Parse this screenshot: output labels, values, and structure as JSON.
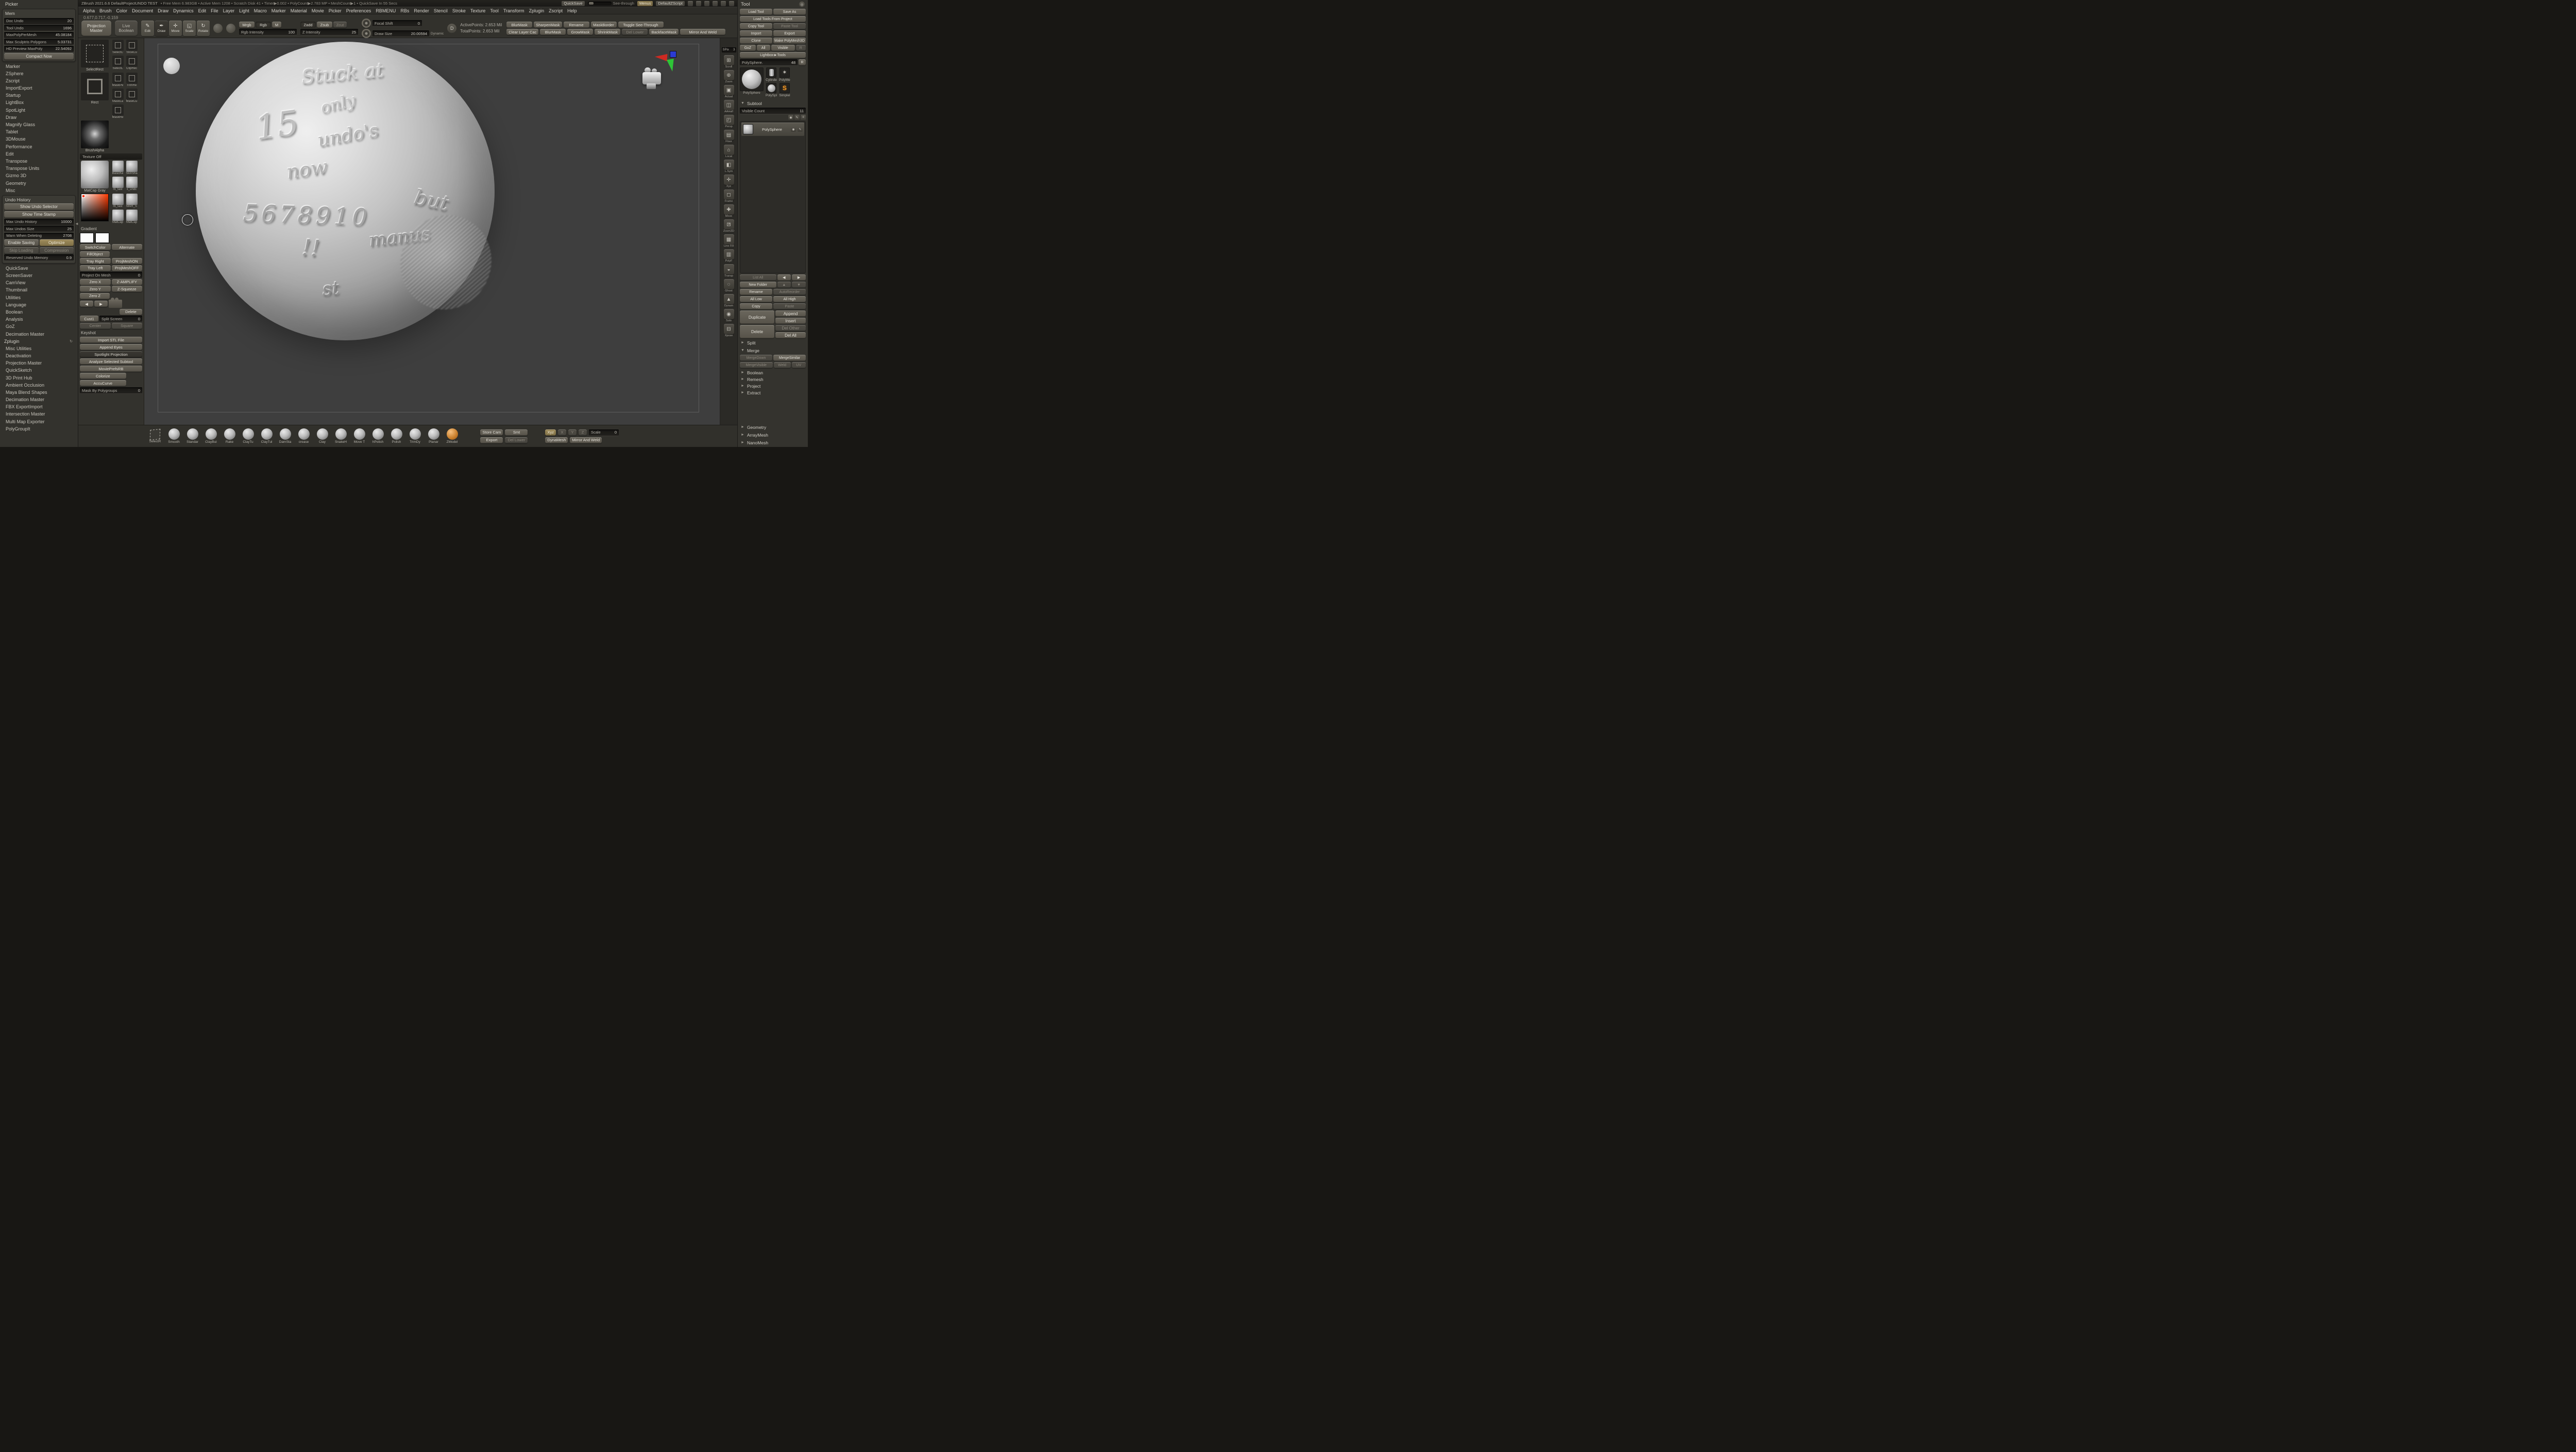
{
  "titlebar": {
    "app_title": "ZBrush 2021.6.6 DefaultProjectUNDO TEST",
    "stats": "• Free Mem 6.983GB • Active Mem 1208 • Scratch Disk 41 • Timer▶0.002 • PolyCount▶2.783 MP • MeshCount▶1 • QuickSave In 55 Secs",
    "quicksave": "QuickSave",
    "see_through": "See-through",
    "menus": "Menus",
    "default_zscript": "DefaultZScript"
  },
  "menubar": [
    "Alpha",
    "Brush",
    "Color",
    "Document",
    "Draw",
    "Dynamics",
    "Edit",
    "File",
    "Layer",
    "Light",
    "Macro",
    "Marker",
    "Material",
    "Movie",
    "Picker",
    "Preferences",
    "RBMENU",
    "RBs",
    "Render",
    "Stencil",
    "Stroke",
    "Texture",
    "Tool",
    "Transform",
    "Zplugin",
    "Zscript",
    "Help"
  ],
  "picker_coords": "0.677,0.717,-0.159",
  "icons": {
    "chevron_right": "►",
    "chevron_left": "◄",
    "chevron_down": "▼",
    "eye": "◉",
    "pencil": "✎",
    "list": "≡",
    "refresh": "↻",
    "circle": "◎"
  },
  "left_tray": {
    "palette_title": "Picker",
    "mem": {
      "title": "Mem",
      "sliders": [
        {
          "label": "Doc Undo",
          "value": "20"
        },
        {
          "label": "Tool Undo",
          "value": "1696"
        },
        {
          "label": "MaxPolyPerMesh",
          "value": "45.08184"
        },
        {
          "label": "Max Sculptris Polygons",
          "value": "5.03731"
        },
        {
          "label": "HD Preview MaxPoly",
          "value": "22.54092"
        }
      ],
      "compact_now": "Compact Now"
    },
    "sections_a": [
      "Marker",
      "ZSphere",
      "Zscript",
      "ImportExport",
      "Startup",
      "LightBox",
      "SpotLight",
      "Draw",
      "Magnify Glass",
      "Tablet",
      "3DMouse",
      "Performance",
      "Edit",
      "Transpose",
      "Transpose Units",
      "Gizmo 3D",
      "Geometry",
      "Misc"
    ],
    "undo_history": {
      "title": "Undo History",
      "buttons_top": [
        "Show Undo Selector",
        "Show Time Stamp"
      ],
      "sliders": [
        {
          "label": "Max Undo History",
          "value": "10000"
        },
        {
          "label": "Max Undos Size",
          "value": "25"
        },
        {
          "label": "Warn When Deleting",
          "value": "2708"
        }
      ],
      "enable_saving": "Enable Saving",
      "optimize": "Optimize",
      "skip_loading": "Skip Loading",
      "compression": "Compression",
      "reserved": {
        "label": "Reserved Undo Memory",
        "value": "0.9"
      }
    },
    "sections_b": [
      "QuickSave",
      "ScreenSaver",
      "CamView",
      "Thumbnail",
      "Utilities",
      "Language",
      "Boolean",
      "Analysis",
      "GoZ",
      "Decimation Master"
    ],
    "zplugin": {
      "title": "Zplugin",
      "items": [
        "Misc Utilities",
        "Deactivation",
        "Projection Master",
        "QuickSketch",
        "3D Print Hub",
        "Ambient Occlusion",
        "Maya Blend Shapes",
        "Decimation Master",
        "FBX ExportImport",
        "Intersection Master",
        "Multi Map Exporter",
        "PolyGroupIt"
      ]
    }
  },
  "toolbar": {
    "projection_master": "Projection Master",
    "live_boolean": "Live Boolean",
    "modes": [
      {
        "glyph": "✎",
        "label": "Edit"
      },
      {
        "glyph": "✒",
        "label": "Draw"
      },
      {
        "glyph": "✛",
        "label": "Move"
      },
      {
        "glyph": "◱",
        "label": "Scale"
      },
      {
        "glyph": "↻",
        "label": "Rotate"
      }
    ],
    "paint": {
      "mrgb": "Mrgb",
      "rgb": "Rgb",
      "m": "M",
      "intensity_label": "Rgb Intensity",
      "intensity_value": "100"
    },
    "sculpt": {
      "zadd": "Zadd",
      "zsub": "Zsub",
      "zcut": "Zcut",
      "intensity_label": "Z Intensity",
      "intensity_value": "25"
    },
    "focal_shift": {
      "label": "Focal Shift",
      "value": "0"
    },
    "draw_size": {
      "label": "Draw Size",
      "value": "20.00594"
    },
    "dynamic_label": "Dynamic",
    "d_toggle": "D",
    "points": {
      "active": "ActivePoints: 2.653 Mil",
      "total": "TotalPoints: 2.653 Mil"
    },
    "mask_row1": [
      "BlurMask",
      "SharpenMask",
      "Rename",
      "MaskBorder"
    ],
    "toggle_see_through": "Toggle See-Through",
    "mask_row2": [
      "Clear Layer Cac",
      "BlurMask",
      "GrowMask",
      "ShrinkMask",
      "Del Lower",
      "BackfaceMask"
    ],
    "mirror_and_weld": "Mirror And Weld"
  },
  "left_shelf": {
    "select_main": "SelectRect",
    "select_minis": [
      "SelectC",
      "SliceCu",
      "SelectL",
      "ClipRec"
    ],
    "stroke_main": "Rect",
    "mask_minis": [
      "MaskPe",
      "TrimRe",
      "MaskLa",
      "MaskCu",
      "MaskRe"
    ],
    "alpha_label": "BrushAlpha",
    "texture_off": "Texture Off",
    "material_main": "MatCap Gray",
    "material_minis": [
      "BasicKe",
      "SkinSha",
      "rb_tast",
      "x_undc"
    ],
    "color_minis": [
      "rb_tast",
      "MAH_S",
      "MatCap",
      "MatCap"
    ],
    "gradient_label": "Gradient",
    "switch_color": "SwitchColor",
    "alternate": "Alternate",
    "fill_object": "FillObject",
    "tray_right": "Tray Right",
    "projmesh_on": "ProjMeshON",
    "tray_left": "Tray Left",
    "projmesh_off": "ProjMeshOFF",
    "project_on_mesh": {
      "label": "Project On Mesh",
      "value": "0"
    },
    "zero_x": "Zero X",
    "z_amplify": "Z-AMPLIFY",
    "zero_y": "Zero Y",
    "z_squeeze": "Z-Squeeze",
    "zero_z": "Zero Z",
    "prev": "◀",
    "next": "▶",
    "delete_btn": "Delete",
    "cust1": "Cust1",
    "split_screen": {
      "label": "Split Screen",
      "value": "0"
    },
    "center": "Center",
    "square": "Square",
    "keyshot": "Keyshot",
    "wide_buttons": [
      "Import STL File",
      "Append Eyes",
      "Spotlight Projection",
      "Analyze Selected Subtool",
      "MoviePrefsRB",
      "Colorize",
      "AccuCurve"
    ],
    "mask_by_polygroups": {
      "label": "Mask By Polygroups",
      "value": "0"
    }
  },
  "canvas": {
    "sculpt_lines": [
      "Stuck at",
      "only",
      "15",
      "undo's",
      "now",
      "5678910",
      "but",
      "!!",
      "manus",
      "st"
    ]
  },
  "right_shelf": {
    "spix_label": "SPix",
    "spix_value": "3",
    "icons": [
      {
        "glyph": "⊞",
        "label": "Scroll"
      },
      {
        "glyph": "⊕",
        "label": "Zoom"
      },
      {
        "glyph": "▣",
        "label": "Actual"
      },
      {
        "glyph": "◫",
        "label": "AAHalf"
      },
      {
        "glyph": "◰",
        "label": "Persp"
      },
      {
        "glyph": "▤",
        "label": "Floor"
      },
      {
        "glyph": "⌂",
        "label": "Local"
      },
      {
        "glyph": "◧",
        "label": "L.Sym"
      },
      {
        "glyph": "✛",
        "label": "Xyz"
      },
      {
        "glyph": "◻",
        "label": "Frame"
      },
      {
        "glyph": "✚",
        "label": "Move"
      },
      {
        "glyph": "⊡",
        "label": "Zoom3D"
      },
      {
        "glyph": "▦",
        "label": "Line Fill"
      },
      {
        "glyph": "▥",
        "label": "PolyF"
      },
      {
        "glyph": "◒",
        "label": "Transp"
      },
      {
        "glyph": "◌",
        "label": "Ghost"
      },
      {
        "glyph": "▲",
        "label": "Dynam"
      },
      {
        "glyph": "◉",
        "label": "Solo"
      },
      {
        "glyph": "⊟",
        "label": "Xpose"
      }
    ]
  },
  "tool_palette": {
    "title": "Tool",
    "load_tool": "Load Tool",
    "save_as": "Save As",
    "load_tools_from_project": "Load Tools From Project",
    "copy_tool": "Copy Tool",
    "paste_tool": "Paste Tool",
    "import_btn": "Import",
    "export_btn": "Export",
    "clone": "Clone",
    "make_polymesh3d": "Make PolyMesh3D",
    "goz": "GoZ",
    "all": "All",
    "visible": "Visible",
    "r": "R",
    "lightbox_tools": "Lightbox►Tools",
    "active_tool": {
      "label": "PolySphere.",
      "value": "48"
    },
    "r_small": "R",
    "current_tool_name": "PolySphere",
    "thumb_labels": [
      "Cylinde",
      "PolySpl",
      "PolyMe",
      "Simplel"
    ],
    "subtool": {
      "title": "Subtool",
      "visible_count": {
        "label": "Visible Count",
        "value": "11"
      },
      "item_name": "PolySphere",
      "list_all": "List All",
      "prev": "◀",
      "next": "▶",
      "new_folder": "New Folder",
      "up": "▲",
      "down": "▼",
      "rename": "Rename",
      "auto_reorder": "AutoReorder",
      "all_low": "All Low",
      "all_high": "All High",
      "copy": "Copy",
      "paste": "Paste",
      "duplicate": "Duplicate",
      "append": "Append",
      "insert": "Insert",
      "delete_btn": "Delete",
      "del_other": "Del Other",
      "del_all": "Del All",
      "split": "Split",
      "merge": "Merge",
      "merge_down": "MergeDown",
      "merge_similar": "MergeSimilar",
      "merge_visible": "MergeVisible",
      "weld": "Weld",
      "uv": "UV",
      "sections": [
        "Boolean",
        "Remesh",
        "Project",
        "Extract"
      ]
    },
    "bottom_sections": [
      "Geometry",
      "ArrayMesh",
      "NanoMesh"
    ]
  },
  "bottom_bar": {
    "current_brush": "SelectR",
    "brushes": [
      "Smooth",
      "Standar",
      "ClayBui",
      "Rake",
      "ClayTu",
      "ClayTul",
      "DamSta",
      "crease",
      "Clay",
      "SnakeH",
      "Move T",
      "hPolish",
      "Polish",
      "TrimDy",
      "Planar",
      "ZModel"
    ],
    "export_btn": "Export",
    "del_lower": "Del Lower",
    "store_cam": "Store Cam",
    "smt": "Smt",
    "dynamesh": "DynaMesh",
    "xyz": "Xyz",
    "x": "X",
    "y": "Y",
    "z": "Z",
    "scale": {
      "label": "Scale",
      "value": "0"
    },
    "mirror_and_weld": "Mirror And Weld"
  }
}
